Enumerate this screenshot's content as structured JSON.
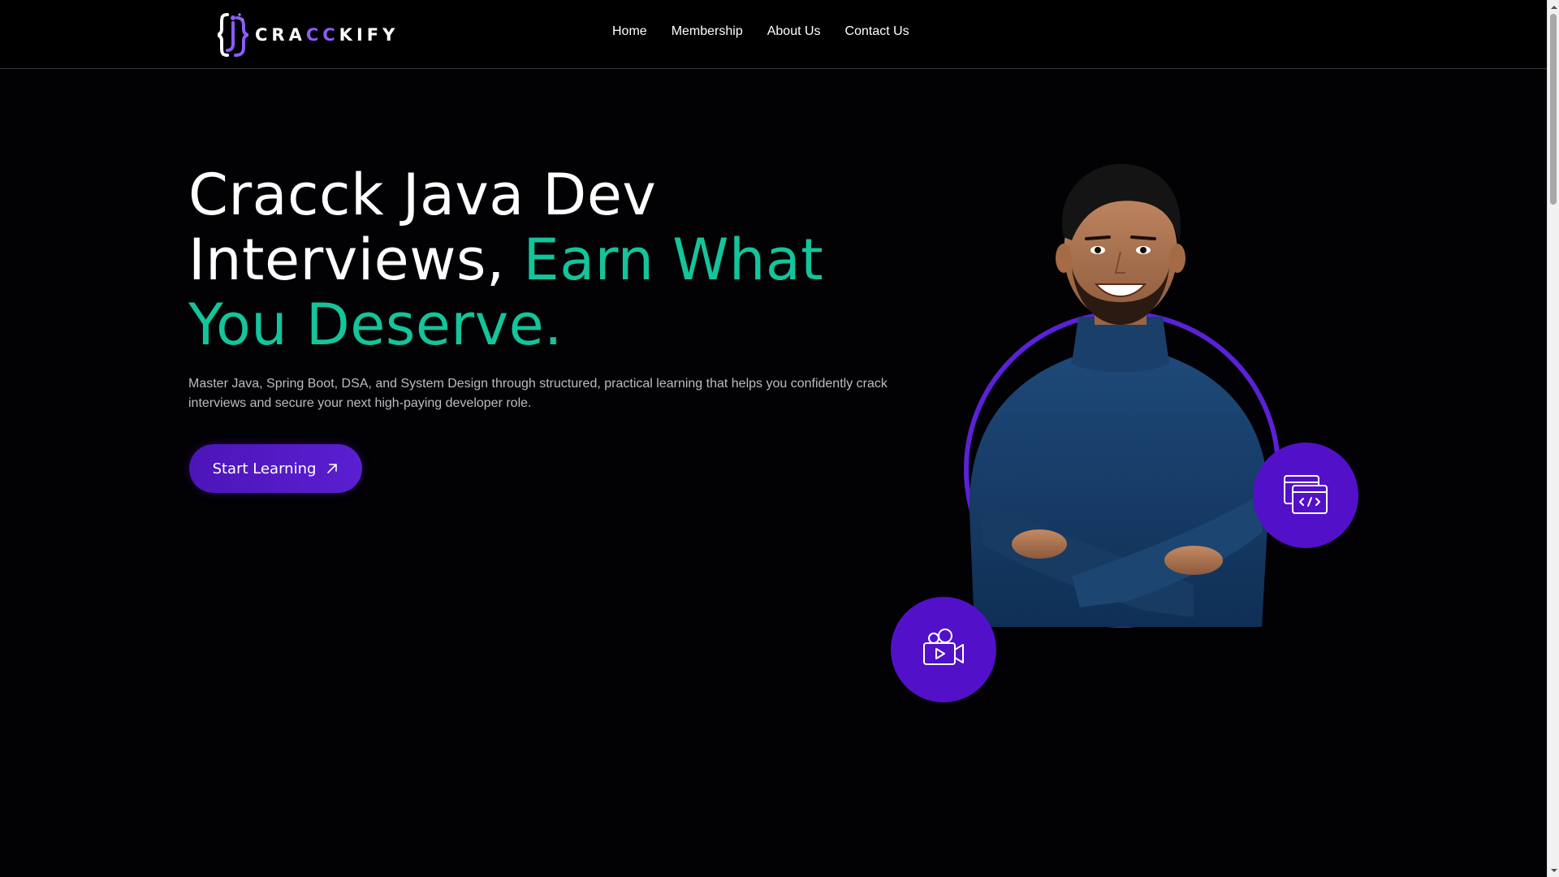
{
  "brand": {
    "name_prefix": "CRA",
    "name_accent": "CC",
    "name_suffix": "KIFY",
    "accent_color": "#8b5cf6"
  },
  "nav": {
    "items": [
      {
        "label": "Home"
      },
      {
        "label": "Membership"
      },
      {
        "label": "About Us"
      },
      {
        "label": "Contact Us"
      }
    ]
  },
  "hero": {
    "title_line1": "Cracck Java Dev",
    "title_line2_white": "Interviews,",
    "title_line2_accent": "Earn What",
    "title_line3_accent": "You Deserve.",
    "accent_color": "#14c49b",
    "subtitle": "Master Java, Spring Boot, DSA, and System Design through structured, practical learning that helps you confidently crack interviews and secure your next high-paying developer role.",
    "cta_label": "Start Learning"
  },
  "visual": {
    "ring_color": "#5b21d6",
    "bubble_color": "#5310c9",
    "icons": [
      "code-window-icon",
      "video-camera-icon"
    ]
  }
}
